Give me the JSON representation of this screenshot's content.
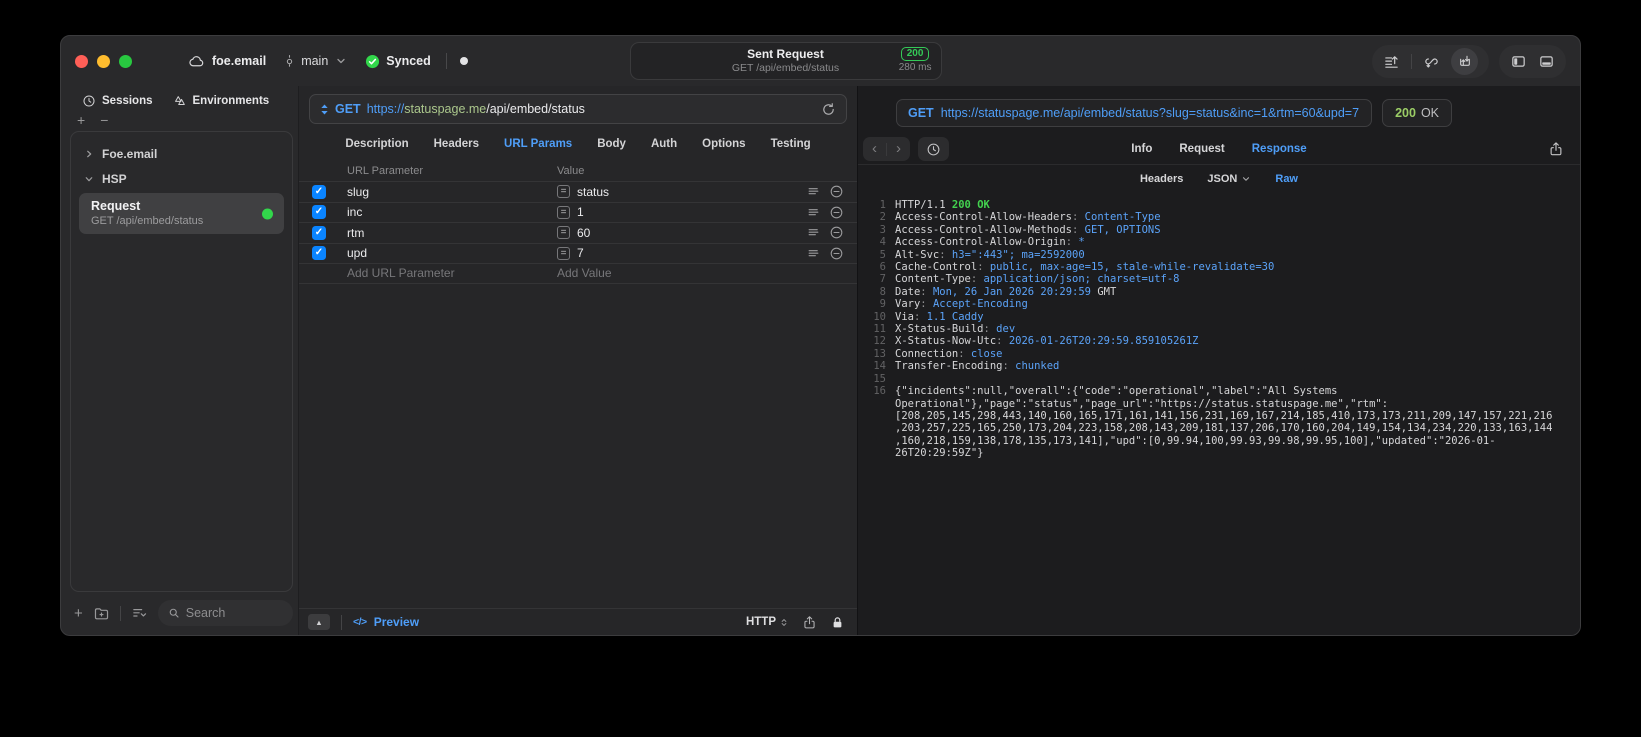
{
  "colors": {
    "accent_blue": "#4f9ef8",
    "success_green": "#32d74b",
    "badge_green": "#34c957",
    "checkbox_blue": "#0a84ff",
    "url_host_green": "#abc78c",
    "response_value_blue": "#5ba3f9",
    "response_green": "#43d34f",
    "response_ok_green": "#9bcd66",
    "traffic_red": "#ff5f57",
    "traffic_yellow": "#febc2e",
    "traffic_green": "#28c840"
  },
  "icons": {
    "plus": "+",
    "minus": "−",
    "collapse_up": "▲",
    "code_preview": "</>",
    "back": "‹",
    "forward": "›"
  },
  "titlebar": {
    "project": "foe.email",
    "branch": "main",
    "sync_label": "Synced",
    "request_summary": {
      "title": "Sent Request",
      "subtitle": "GET /api/embed/status",
      "status_code": "200",
      "duration": "280 ms"
    }
  },
  "sidebar": {
    "tabs": {
      "sessions": "Sessions",
      "environments": "Environments"
    },
    "tree": [
      {
        "label": "Foe.email",
        "state": "collapsed"
      },
      {
        "label": "HSP",
        "state": "expanded"
      }
    ],
    "request_item": {
      "title": "Request",
      "subtitle": "GET /api/embed/status"
    },
    "search_placeholder": "Search"
  },
  "editor": {
    "method": "GET",
    "url": {
      "scheme": "https://",
      "host": "statuspage.me",
      "path": "/api/embed/status"
    },
    "tabs": [
      {
        "label": "Description"
      },
      {
        "label": "Headers"
      },
      {
        "label": "URL Params",
        "active": true
      },
      {
        "label": "Body"
      },
      {
        "label": "Auth"
      },
      {
        "label": "Options"
      },
      {
        "label": "Testing"
      }
    ],
    "params": {
      "columns": {
        "name": "URL Parameter",
        "value": "Value"
      },
      "rows": [
        {
          "name": "slug",
          "value": "status",
          "enabled": true
        },
        {
          "name": "inc",
          "value": "1",
          "enabled": true
        },
        {
          "name": "rtm",
          "value": "60",
          "enabled": true
        },
        {
          "name": "upd",
          "value": "7",
          "enabled": true
        }
      ],
      "add_name": "Add URL Parameter",
      "add_value": "Add Value"
    },
    "footer": {
      "preview": "Preview",
      "protocol": "HTTP"
    }
  },
  "response": {
    "request_line": {
      "method": "GET",
      "url": "https://statuspage.me/api/embed/status?slug=status&inc=1&rtm=60&upd=7"
    },
    "status": {
      "code": "200",
      "text": "OK"
    },
    "tabs": [
      {
        "label": "Info"
      },
      {
        "label": "Request"
      },
      {
        "label": "Response",
        "active": true
      }
    ],
    "view_tabs": [
      {
        "label": "Headers"
      },
      {
        "label": "JSON",
        "has_menu": true
      },
      {
        "label": "Raw",
        "active": true
      }
    ],
    "lines": [
      {
        "n": "1",
        "parts": [
          {
            "t": "HTTP/1.1 ",
            "c": "w"
          },
          {
            "t": "200 OK",
            "c": "g"
          }
        ]
      },
      {
        "n": "2",
        "parts": [
          {
            "t": "Access-Control-Allow-Headers",
            "c": "w"
          },
          {
            "t": ": ",
            "c": "p"
          },
          {
            "t": "Content-Type",
            "c": "b"
          }
        ]
      },
      {
        "n": "3",
        "parts": [
          {
            "t": "Access-Control-Allow-Methods",
            "c": "w"
          },
          {
            "t": ": ",
            "c": "p"
          },
          {
            "t": "GET, OPTIONS",
            "c": "b"
          }
        ]
      },
      {
        "n": "4",
        "parts": [
          {
            "t": "Access-Control-Allow-Origin",
            "c": "w"
          },
          {
            "t": ": ",
            "c": "p"
          },
          {
            "t": "*",
            "c": "b"
          }
        ]
      },
      {
        "n": "5",
        "parts": [
          {
            "t": "Alt-Svc",
            "c": "w"
          },
          {
            "t": ": ",
            "c": "p"
          },
          {
            "t": "h3=\":443\"; ma=2592000",
            "c": "b"
          }
        ]
      },
      {
        "n": "6",
        "parts": [
          {
            "t": "Cache-Control",
            "c": "w"
          },
          {
            "t": ": ",
            "c": "p"
          },
          {
            "t": "public, max-age=15, stale-while-revalidate=30",
            "c": "b"
          }
        ]
      },
      {
        "n": "7",
        "parts": [
          {
            "t": "Content-Type",
            "c": "w"
          },
          {
            "t": ": ",
            "c": "p"
          },
          {
            "t": "application/json; charset=utf-8",
            "c": "b"
          }
        ]
      },
      {
        "n": "8",
        "parts": [
          {
            "t": "Date",
            "c": "w"
          },
          {
            "t": ": ",
            "c": "p"
          },
          {
            "t": "Mon, 26 Jan 2026 20:29:59 ",
            "c": "b"
          },
          {
            "t": "GMT",
            "c": "w"
          }
        ]
      },
      {
        "n": "9",
        "parts": [
          {
            "t": "Vary",
            "c": "w"
          },
          {
            "t": ": ",
            "c": "p"
          },
          {
            "t": "Accept-Encoding",
            "c": "b"
          }
        ]
      },
      {
        "n": "10",
        "parts": [
          {
            "t": "Via",
            "c": "w"
          },
          {
            "t": ": ",
            "c": "p"
          },
          {
            "t": "1.1 Caddy",
            "c": "b"
          }
        ]
      },
      {
        "n": "11",
        "parts": [
          {
            "t": "X-Status-Build",
            "c": "w"
          },
          {
            "t": ": ",
            "c": "p"
          },
          {
            "t": "dev",
            "c": "b"
          }
        ]
      },
      {
        "n": "12",
        "parts": [
          {
            "t": "X-Status-Now-Utc",
            "c": "w"
          },
          {
            "t": ": ",
            "c": "p"
          },
          {
            "t": "2026-01-26T20:29:59.859105261Z",
            "c": "b"
          }
        ]
      },
      {
        "n": "13",
        "parts": [
          {
            "t": "Connection",
            "c": "w"
          },
          {
            "t": ": ",
            "c": "p"
          },
          {
            "t": "close",
            "c": "b"
          }
        ]
      },
      {
        "n": "14",
        "parts": [
          {
            "t": "Transfer-Encoding",
            "c": "w"
          },
          {
            "t": ": ",
            "c": "p"
          },
          {
            "t": "chunked",
            "c": "b"
          }
        ]
      },
      {
        "n": "15",
        "parts": []
      },
      {
        "n": "16",
        "parts": [
          {
            "t": "{\"incidents\":null,\"overall\":{\"code\":\"operational\",\"label\":\"All Systems Operational\"},\"page\":\"status\",\"page_url\":\"https://status.statuspage.me\",\"rtm\":[208,205,145,298,443,140,160,165,171,161,141,156,231,169,167,214,185,410,173,173,211,209,147,157,221,216,203,257,225,165,250,173,204,223,158,208,143,209,181,137,206,170,160,204,149,154,134,234,220,133,163,144,160,218,159,138,178,135,173,141],\"upd\":[0,99.94,100,99.93,99.98,99.95,100],\"updated\":\"2026-01-26T20:29:59Z\"}",
            "c": "w"
          }
        ]
      }
    ]
  }
}
